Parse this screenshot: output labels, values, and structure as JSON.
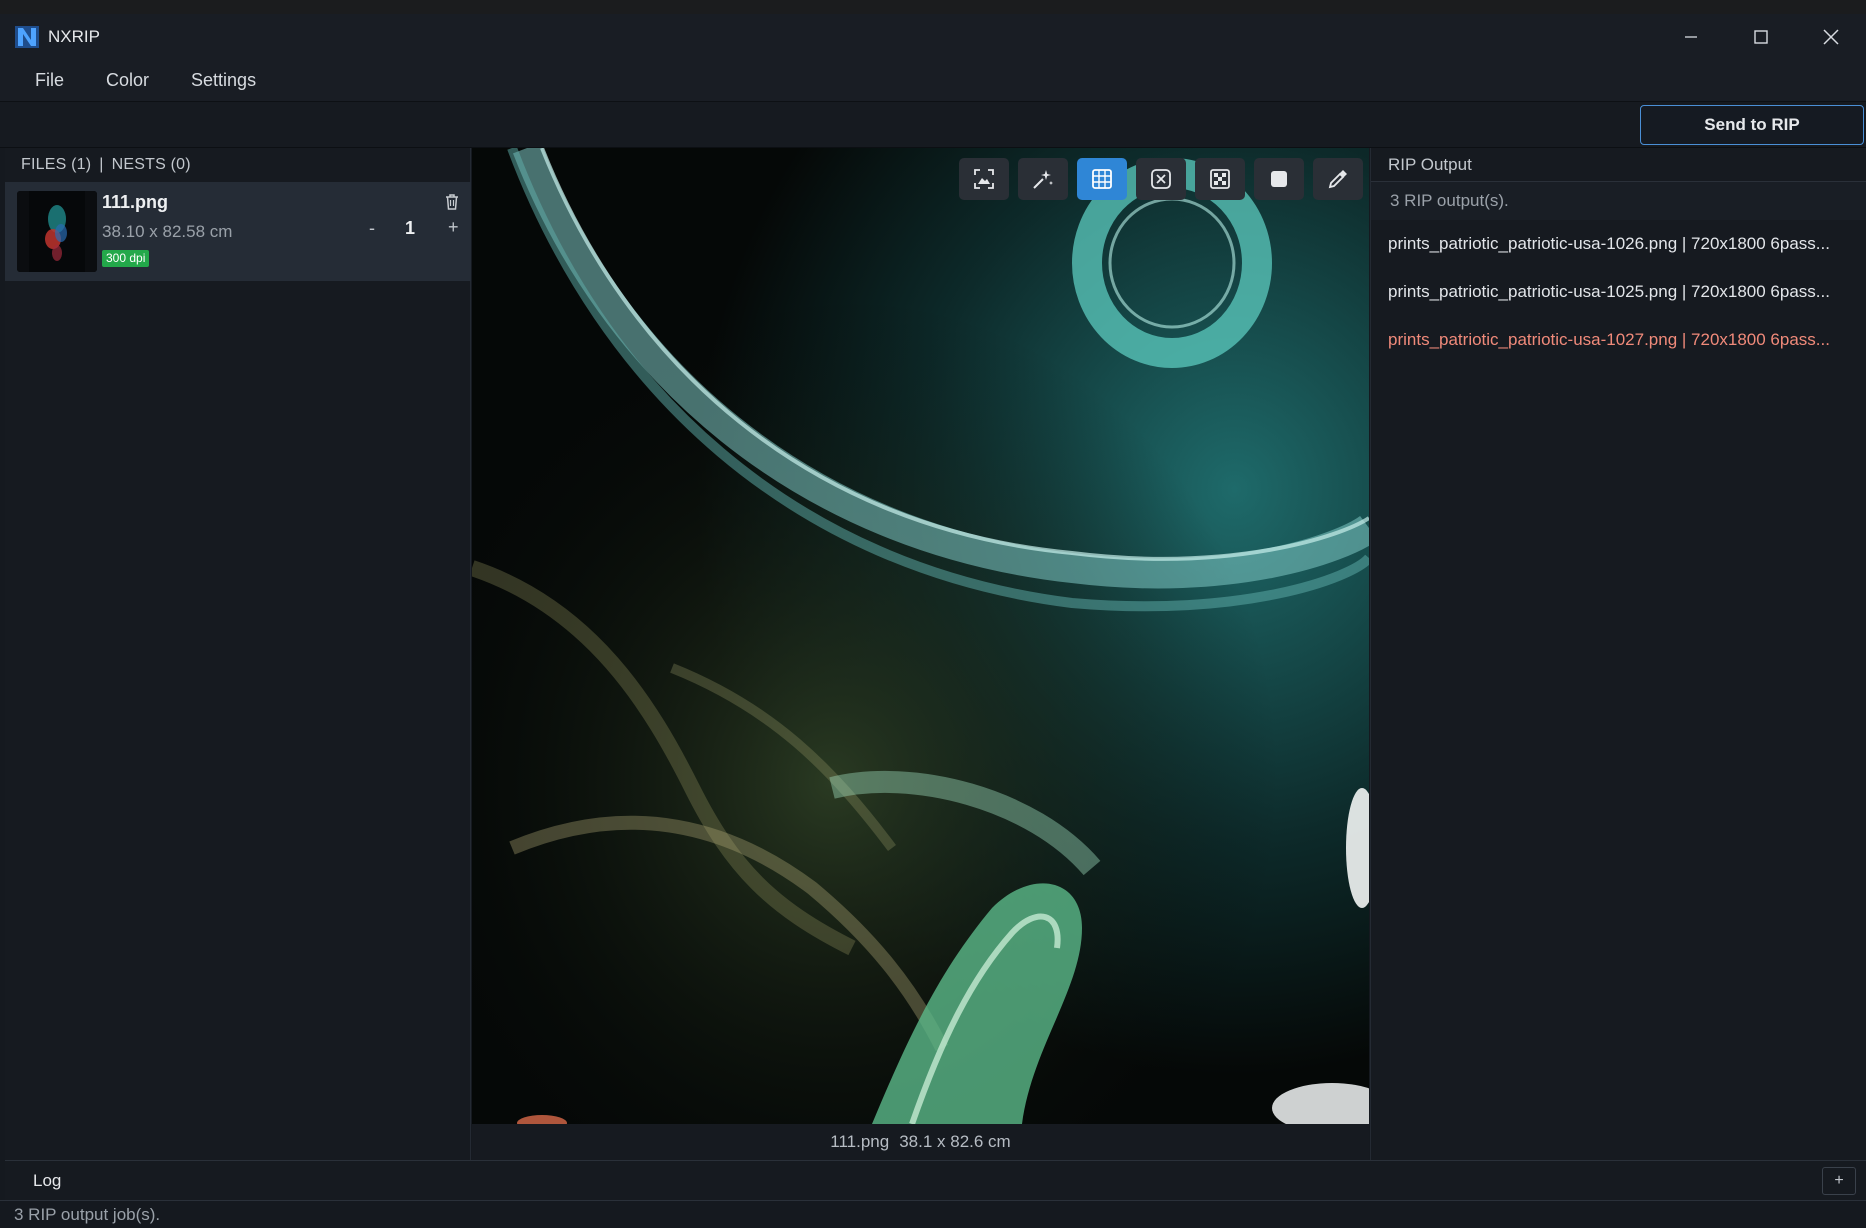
{
  "app": {
    "title": "NXRIP"
  },
  "menu": {
    "items": [
      "File",
      "Color",
      "Settings"
    ]
  },
  "toolbar": {
    "send_label": "Send to RIP"
  },
  "files": {
    "files_label": "FILES (1)",
    "separator": "|",
    "nests_label": "NESTS (0)",
    "items": [
      {
        "name": "111.png",
        "size": "38.10 x 82.58 cm",
        "dpi": "300 dpi",
        "quantity": "1",
        "minus": "-",
        "plus": "+"
      }
    ]
  },
  "preview": {
    "tools": [
      "fit-icon",
      "magic-wand-icon",
      "grid-icon",
      "close-box-icon",
      "checker-icon",
      "square-icon",
      "eyedropper-icon"
    ],
    "active_tool": "grid-icon",
    "footer_name": "111.png",
    "footer_size": "38.1 x 82.6 cm"
  },
  "rip": {
    "title": "RIP Output",
    "count": "3 RIP output(s).",
    "items": [
      {
        "text": "prints_patriotic_patriotic-usa-1026.png | 720x1800 6pass...",
        "status": "ok"
      },
      {
        "text": "prints_patriotic_patriotic-usa-1025.png | 720x1800 6pass...",
        "status": "ok"
      },
      {
        "text": "prints_patriotic_patriotic-usa-1027.png | 720x1800 6pass...",
        "status": "error"
      }
    ]
  },
  "log": {
    "title": "Log",
    "plus": "+",
    "status": "3 RIP output job(s)."
  },
  "colors": {
    "accent": "#2f86d6",
    "badge": "#23a84a",
    "error": "#f08a7a"
  }
}
